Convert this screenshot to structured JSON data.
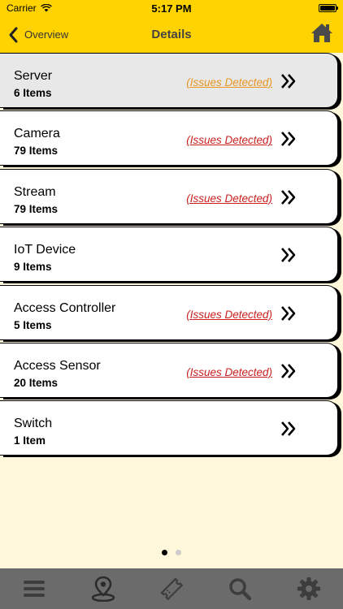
{
  "status_bar": {
    "carrier": "Carrier",
    "time": "5:17 PM"
  },
  "nav": {
    "back_label": "Overview",
    "title": "Details"
  },
  "rows": [
    {
      "name": "Server",
      "count": "6 Items",
      "issues": "(Issues Detected)",
      "issue_color": "#e89520"
    },
    {
      "name": "Camera",
      "count": "79 Items",
      "issues": "(Issues Detected)",
      "issue_color": "#c8201e"
    },
    {
      "name": "Stream",
      "count": "79 Items",
      "issues": "(Issues Detected)",
      "issue_color": "#c8201e"
    },
    {
      "name": "IoT Device",
      "count": "9 Items",
      "issues": ""
    },
    {
      "name": "Access Controller",
      "count": "5 Items",
      "issues": "(Issues Detected)",
      "issue_color": "#c8201e"
    },
    {
      "name": "Access Sensor",
      "count": "20 Items",
      "issues": "(Issues Detected)",
      "issue_color": "#c8201e"
    },
    {
      "name": "Switch",
      "count": "1 Item",
      "issues": ""
    }
  ],
  "tab_bar": {
    "items": [
      "menu-icon",
      "map-pin-icon",
      "ticket-icon",
      "search-icon",
      "gear-icon"
    ],
    "active": "map-pin-icon"
  },
  "colors": {
    "accent": "#ffd300",
    "background": "#fef7dc",
    "tab_bar": "#6b6b6b",
    "issue_red": "#c8201e",
    "issue_orange": "#e89520"
  }
}
